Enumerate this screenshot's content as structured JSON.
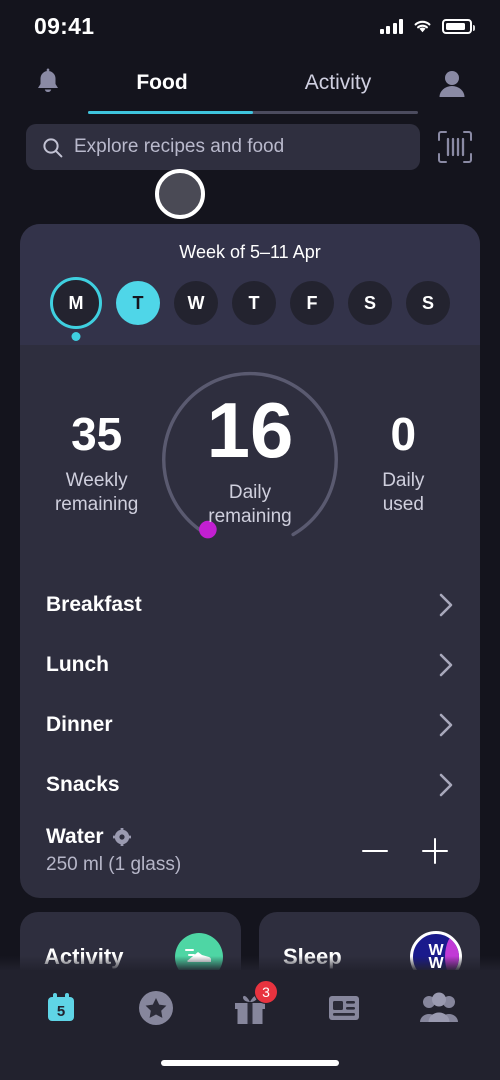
{
  "status_bar": {
    "time": "09:41",
    "cellular_icon": "signal-bars-icon",
    "wifi_icon": "wifi-icon",
    "battery_icon": "battery-icon"
  },
  "header": {
    "notifications_icon": "bell-icon",
    "profile_icon": "profile-avatar-icon",
    "tabs": [
      {
        "label": "Food",
        "active": true
      },
      {
        "label": "Activity",
        "active": false
      }
    ]
  },
  "search": {
    "placeholder": "Explore recipes and food",
    "icon": "search-icon",
    "scan_icon": "barcode-scanner-icon"
  },
  "cursor": {
    "name": "touch-cursor-indicator"
  },
  "week": {
    "title": "Week of 5–11 Apr",
    "days": [
      {
        "letter": "M",
        "state": "today"
      },
      {
        "letter": "T",
        "state": "selected"
      },
      {
        "letter": "W",
        "state": "default"
      },
      {
        "letter": "T",
        "state": "default"
      },
      {
        "letter": "F",
        "state": "default"
      },
      {
        "letter": "S",
        "state": "default"
      },
      {
        "letter": "S",
        "state": "default"
      }
    ]
  },
  "summary": {
    "weekly_remaining": {
      "value": "35",
      "label_line1": "Weekly",
      "label_line2": "remaining"
    },
    "daily_remaining": {
      "value": "16",
      "label_line1": "Daily",
      "label_line2": "remaining"
    },
    "daily_used": {
      "value": "0",
      "label_line1": "Daily",
      "label_line2": "used"
    },
    "ring_track_color": "#5a5a70",
    "ring_marker_color": "#c21fd1"
  },
  "meals": [
    {
      "name": "Breakfast",
      "chevron": "chevron-right-icon"
    },
    {
      "name": "Lunch",
      "chevron": "chevron-right-icon"
    },
    {
      "name": "Dinner",
      "chevron": "chevron-right-icon"
    },
    {
      "name": "Snacks",
      "chevron": "chevron-right-icon"
    }
  ],
  "water": {
    "title": "Water",
    "settings_icon": "gear-icon",
    "amount": "250 ml (1 glass)",
    "decrement_label": "−",
    "increment_label": "+"
  },
  "mini_cards": [
    {
      "title": "Activity",
      "icon": "running-shoe-icon",
      "icon_bg": "#4ed6a4"
    },
    {
      "title": "Sleep",
      "icon": "ww-logo-icon",
      "logo_text_top": "W",
      "logo_text_bottom": "W"
    }
  ],
  "bottom_nav": [
    {
      "name": "today-calendar",
      "icon": "calendar-icon",
      "day_number": "5",
      "active": true
    },
    {
      "name": "favorites",
      "icon": "star-circle-icon",
      "active": false
    },
    {
      "name": "rewards",
      "icon": "gift-icon",
      "badge": "3",
      "active": false
    },
    {
      "name": "articles",
      "icon": "article-icon",
      "active": false
    },
    {
      "name": "community",
      "icon": "people-icon",
      "active": false
    }
  ],
  "home_indicator": "home-indicator-bar",
  "colors": {
    "background": "#14141d",
    "card": "#2e2e3e",
    "accent_cyan": "#4fd6e8",
    "accent_magenta": "#c21fd1",
    "badge_red": "#e8333f"
  }
}
